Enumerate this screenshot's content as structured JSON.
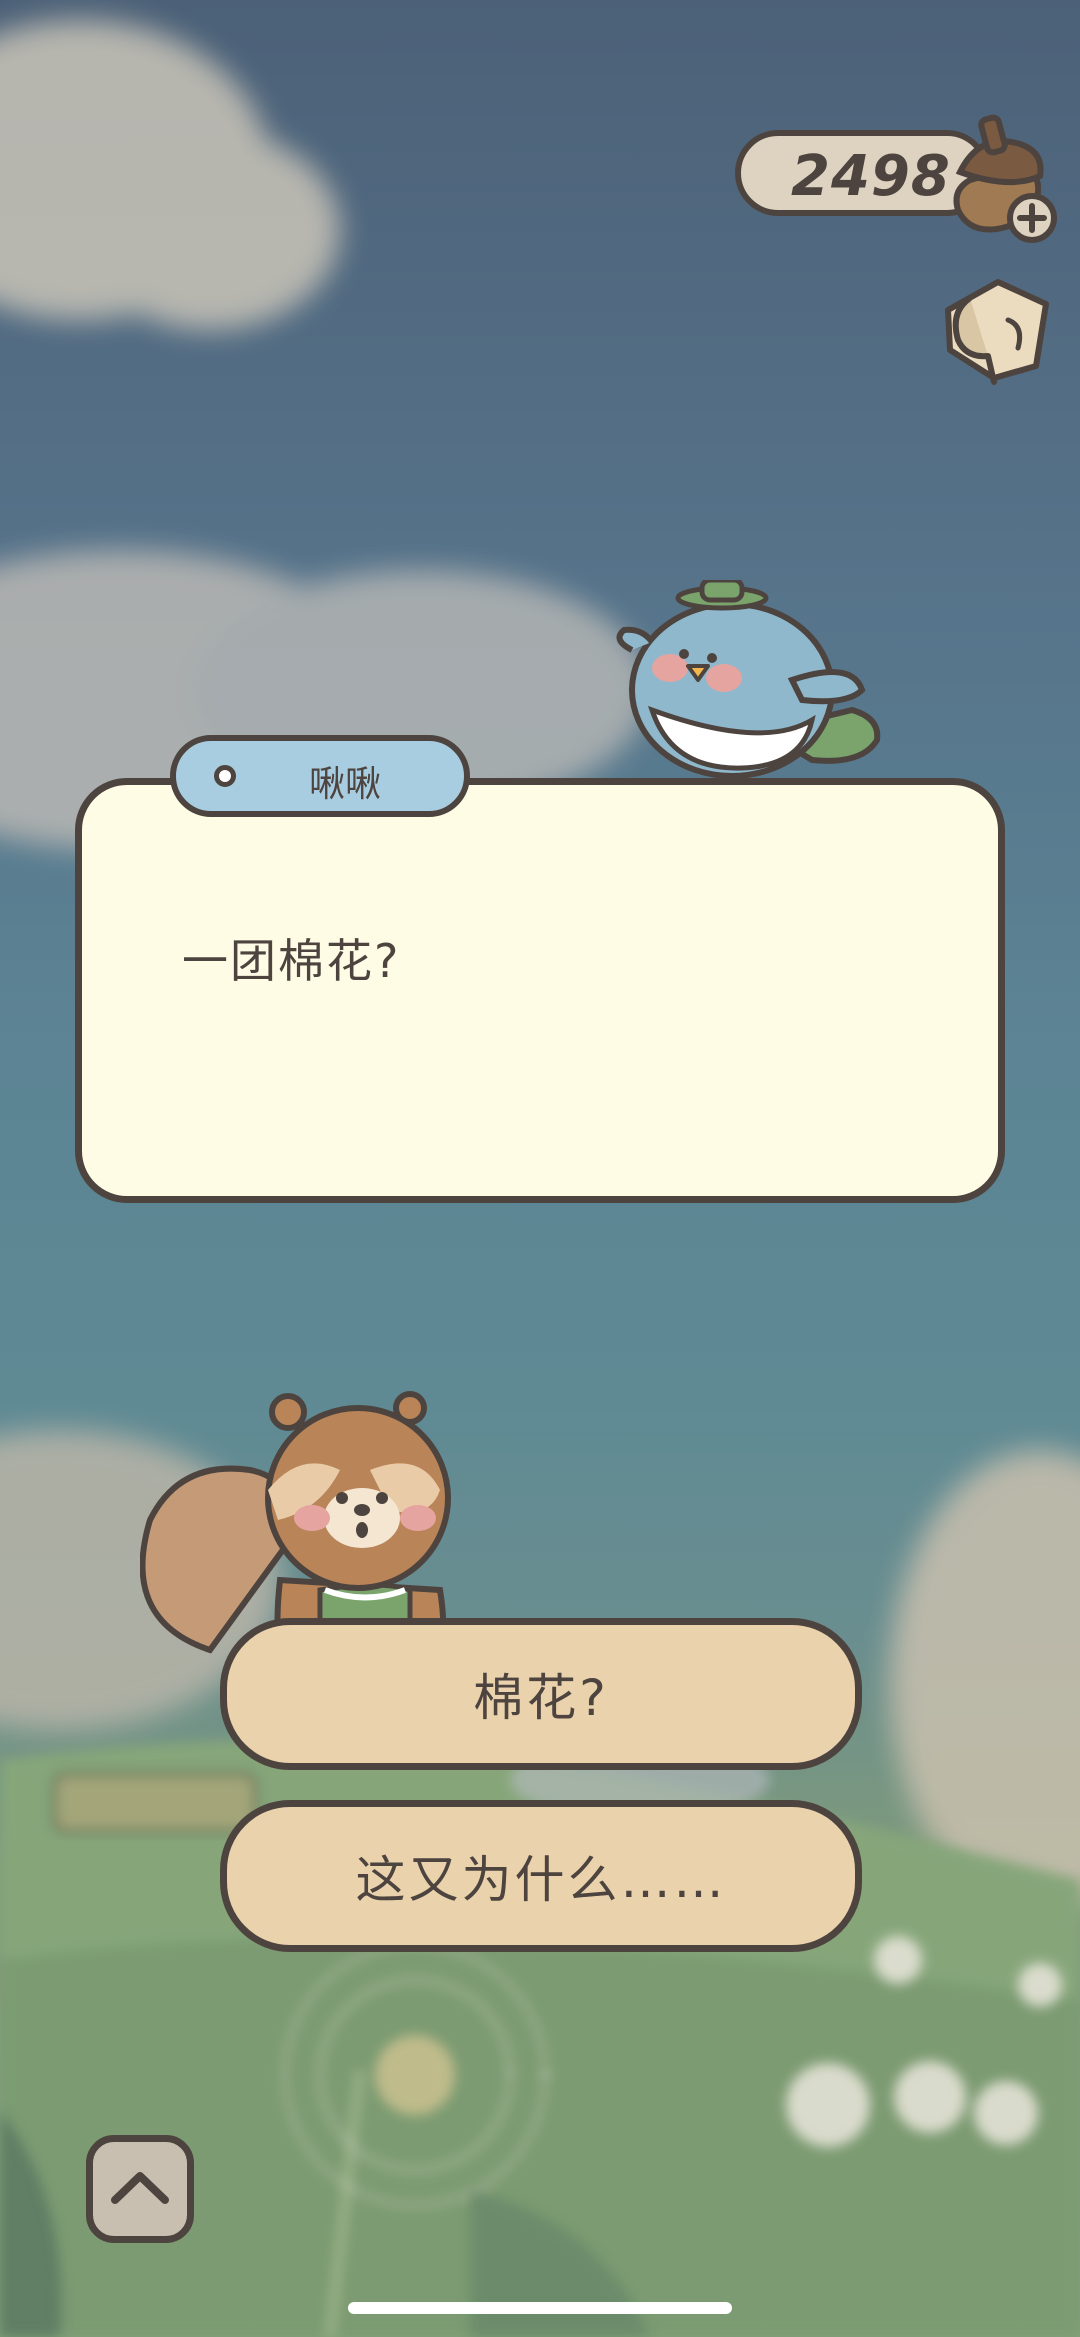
{
  "hud": {
    "currency_value": "2498"
  },
  "dialog": {
    "speaker": "啾啾",
    "text": "一团棉花?"
  },
  "choices": [
    {
      "label": "棉花?"
    },
    {
      "label": "这又为什么……"
    }
  ],
  "icons": {
    "acorn": "acorn-plus-icon",
    "note": "note-icon",
    "up": "chevron-up-icon"
  },
  "colors": {
    "outline": "#4d443f",
    "dialog_bg": "#fffce6",
    "name_tag_bg": "#a8cde0",
    "choice_bg": "#e9d2ac"
  }
}
